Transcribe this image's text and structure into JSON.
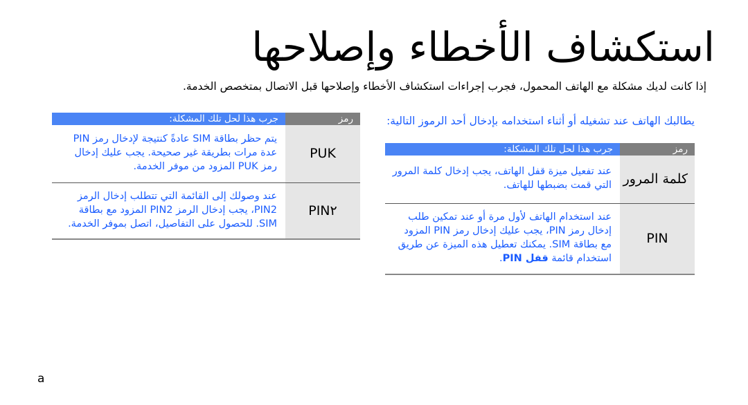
{
  "page": {
    "title": "استكشاف الأخطاء وإصلاحها",
    "intro": "إذا كانت لديك مشكلة مع الهاتف المحمول، فجرب إجراءات استكشاف الأخطاء وإصلاحها قبل الاتصال بمتخصص الخدمة.",
    "page_number": "a"
  },
  "right_section": {
    "lead": "يطالبك الهاتف عند تشغيله أو أثناء استخدامه بإدخال أحد الرموز التالية:",
    "table": {
      "headers": {
        "code": "رمز",
        "solution": "جرب هذا لحل تلك المشكلة:"
      },
      "rows": [
        {
          "code": "كلمة المرور",
          "solution": "عند تفعيل ميزة قفل الهاتف، يجب إدخال كلمة المرور التي قمت بضبطها للهاتف."
        },
        {
          "code": "PIN",
          "solution": "عند استخدام الهاتف لأول مرة أو عند تمكين طلب إدخال رمز PIN، يجب عليك إدخال رمز PIN المزود مع بطاقة SIM.  يمكنك تعطيل هذه الميزة عن طريق استخدام قائمة",
          "solution_bold": "قفل PIN",
          "solution_end": "."
        }
      ]
    }
  },
  "left_section": {
    "table": {
      "headers": {
        "code": "رمز",
        "solution": "جرب هذا لحل تلك المشكلة:"
      },
      "rows": [
        {
          "code": "PUK",
          "solution": "يتم حظر بطاقة SIM عادةً كنتيجة لإدخال رمز PIN عدة مرات بطريقة غير صحيحة. يجب عليك إدخال رمز PUK المزود من موفر الخدمة."
        },
        {
          "code": "PIN٢",
          "solution": "عند وصولك إلى القائمة التي تتطلب إدخال الرمز PIN2، يجب إدخال الرمز PIN2 المزود مع بطاقة SIM. للحصول على التفاصيل، اتصل بموفر الخدمة."
        }
      ]
    }
  },
  "colors": {
    "header_code_bg": "#7f7f7f",
    "header_solution_bg": "#4a84f5",
    "code_cell_bg": "#e6e6e6",
    "solution_text": "#1a5cff"
  }
}
